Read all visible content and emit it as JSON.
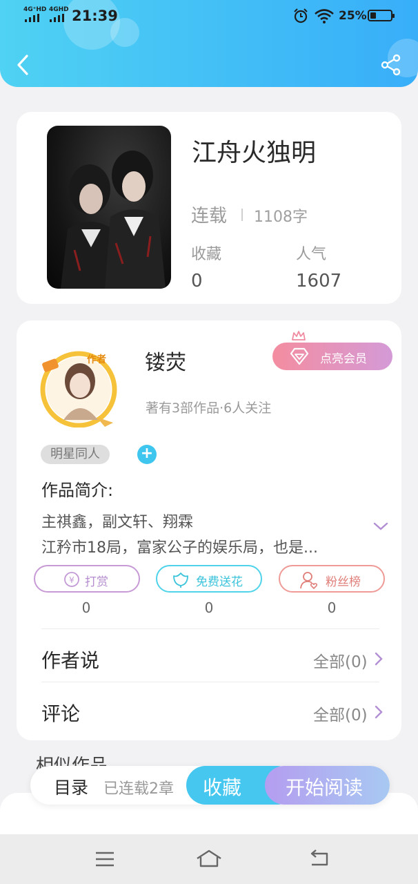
{
  "status_bar": {
    "signal1": "4G⁺HD",
    "signal2": "4GHD",
    "time": "21:39",
    "battery_percent": "25%"
  },
  "header": {
    "back_icon": "chevron-left-icon",
    "share_icon": "share-icon"
  },
  "book": {
    "title": "江舟火独明",
    "status": "连载",
    "word_count": "1108字",
    "favorites_label": "收藏",
    "favorites_value": "0",
    "popularity_label": "人气",
    "popularity_value": "1607"
  },
  "author": {
    "name": "镂荧",
    "badge_text": "作者",
    "meta": "著有3部作品·6人关注",
    "member_button": "点亮会员",
    "tag": "明星同人",
    "add_tag": "+",
    "intro_title": "作品简介:",
    "intro_line1": "主祺鑫，副文轩、翔霖",
    "intro_line2": "江矜市18局，富家公子的娱乐局，也是..."
  },
  "support": {
    "reward_label": "打赏",
    "reward_count": "0",
    "flower_label": "免费送花",
    "flower_count": "0",
    "fans_label": "粉丝榜",
    "fans_count": "0"
  },
  "sections": {
    "author_says_label": "作者说",
    "author_says_all": "全部(0)",
    "comments_label": "评论",
    "comments_all": "全部(0)",
    "similar_title": "相似作品"
  },
  "action_bar": {
    "toc": "目录",
    "chapters": "已连载2章",
    "favorite": "收藏",
    "start_reading": "开始阅读"
  },
  "colors": {
    "header_start": "#4fd2f3",
    "header_end": "#38aef9",
    "accent_blue": "#46c7ef",
    "accent_purple": "#b49df0",
    "member_pink": "#f48da0"
  }
}
